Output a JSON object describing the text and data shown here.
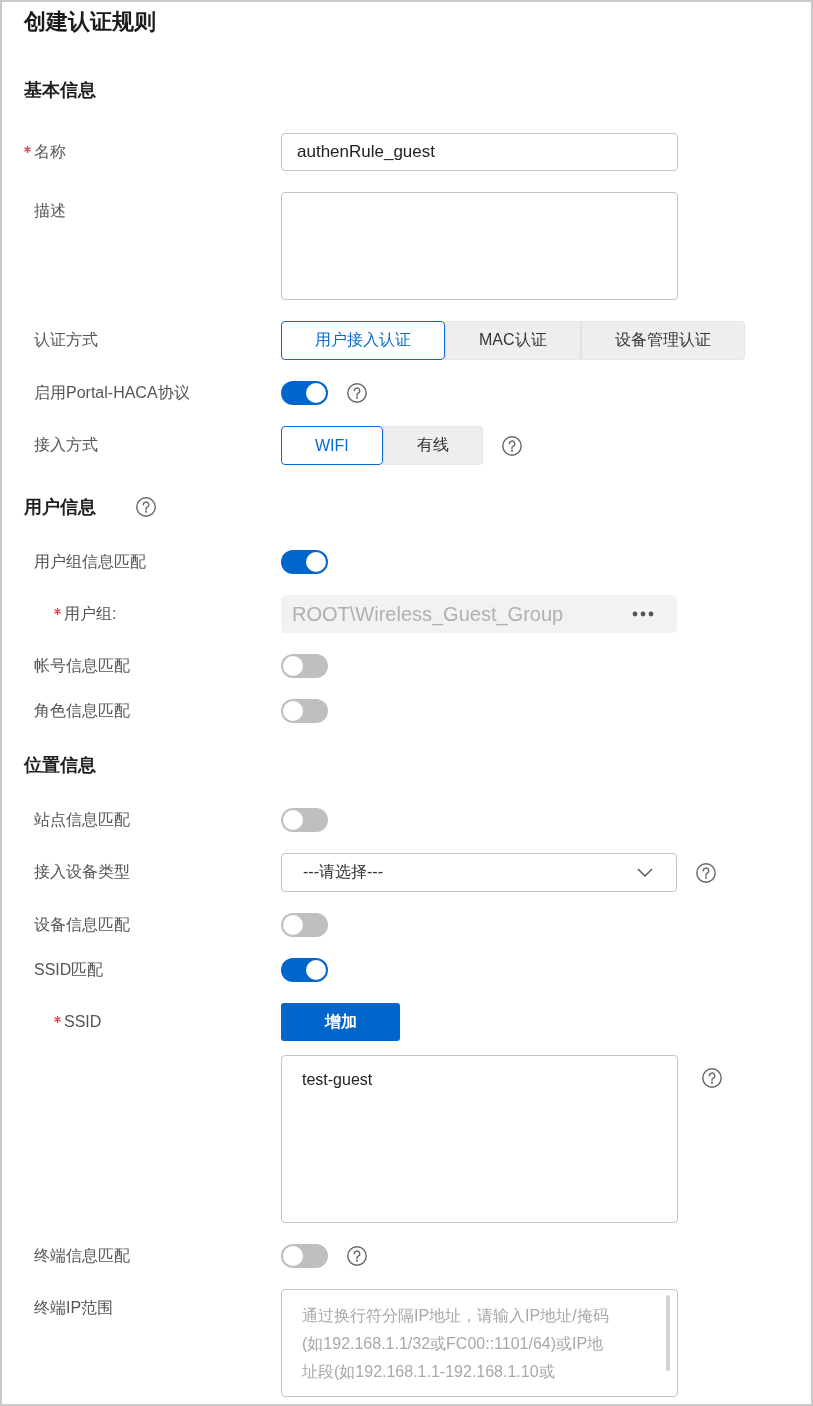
{
  "title": "创建认证规则",
  "sections": [
    {
      "heading": "基本信息",
      "help": false,
      "fields": [
        {
          "kind": "text",
          "label": "名称",
          "required": true,
          "help": false,
          "value": "authenRule_guest"
        },
        {
          "kind": "textarea",
          "label": "描述",
          "required": false,
          "help": false
        },
        {
          "kind": "segmented",
          "label": "认证方式",
          "required": false,
          "help": false,
          "options": [
            {
              "label": "用户接入认证",
              "selected": true
            },
            {
              "label": "MAC认证",
              "selected": false
            },
            {
              "label": "设备管理认证",
              "selected": false
            }
          ]
        },
        {
          "kind": "toggle",
          "label": "启用Portal-HACA协议",
          "required": false,
          "help": true,
          "on": true
        },
        {
          "kind": "segmented",
          "label": "接入方式",
          "required": false,
          "help": true,
          "options": [
            {
              "label": "WIFI",
              "selected": true
            },
            {
              "label": "有线",
              "selected": false
            }
          ]
        }
      ]
    },
    {
      "heading": "用户信息",
      "help": true,
      "fields": [
        {
          "kind": "toggle",
          "label": "用户组信息匹配",
          "required": false,
          "help": false,
          "on": true,
          "children": [
            {
              "kind": "picker",
              "label": "用户组:",
              "required": true,
              "help": false,
              "disabled": true,
              "value": "ROOT\\Wireless_Guest_Group"
            }
          ]
        },
        {
          "kind": "toggle",
          "label": "帐号信息匹配",
          "required": false,
          "help": false,
          "on": false
        },
        {
          "kind": "toggle",
          "label": "角色信息匹配",
          "required": false,
          "help": false,
          "on": false
        }
      ]
    },
    {
      "heading": "位置信息",
      "help": false,
      "fields": [
        {
          "kind": "toggle",
          "label": "站点信息匹配",
          "required": false,
          "help": false,
          "on": false
        },
        {
          "kind": "select",
          "label": "接入设备类型",
          "required": false,
          "help": true,
          "value": "---请选择---"
        },
        {
          "kind": "toggle",
          "label": "设备信息匹配",
          "required": false,
          "help": false,
          "on": false
        },
        {
          "kind": "toggle",
          "label": "SSID匹配",
          "required": false,
          "help": false,
          "on": true,
          "children": [
            {
              "kind": "add-list",
              "label": "SSID",
              "required": true,
              "help": true,
              "button": "增加",
              "value": "test-guest"
            }
          ]
        },
        {
          "kind": "toggle",
          "label": "终端信息匹配",
          "required": false,
          "help": true,
          "on": false
        },
        {
          "kind": "textarea",
          "label": "终端IP范围",
          "required": false,
          "help": false,
          "placeholder": "通过换行符分隔IP地址，请输入IP地址/掩码(如192.168.1.1/32或FC00::1101/64)或IP地址段(如192.168.1.1-192.168.1.10或"
        }
      ]
    }
  ]
}
